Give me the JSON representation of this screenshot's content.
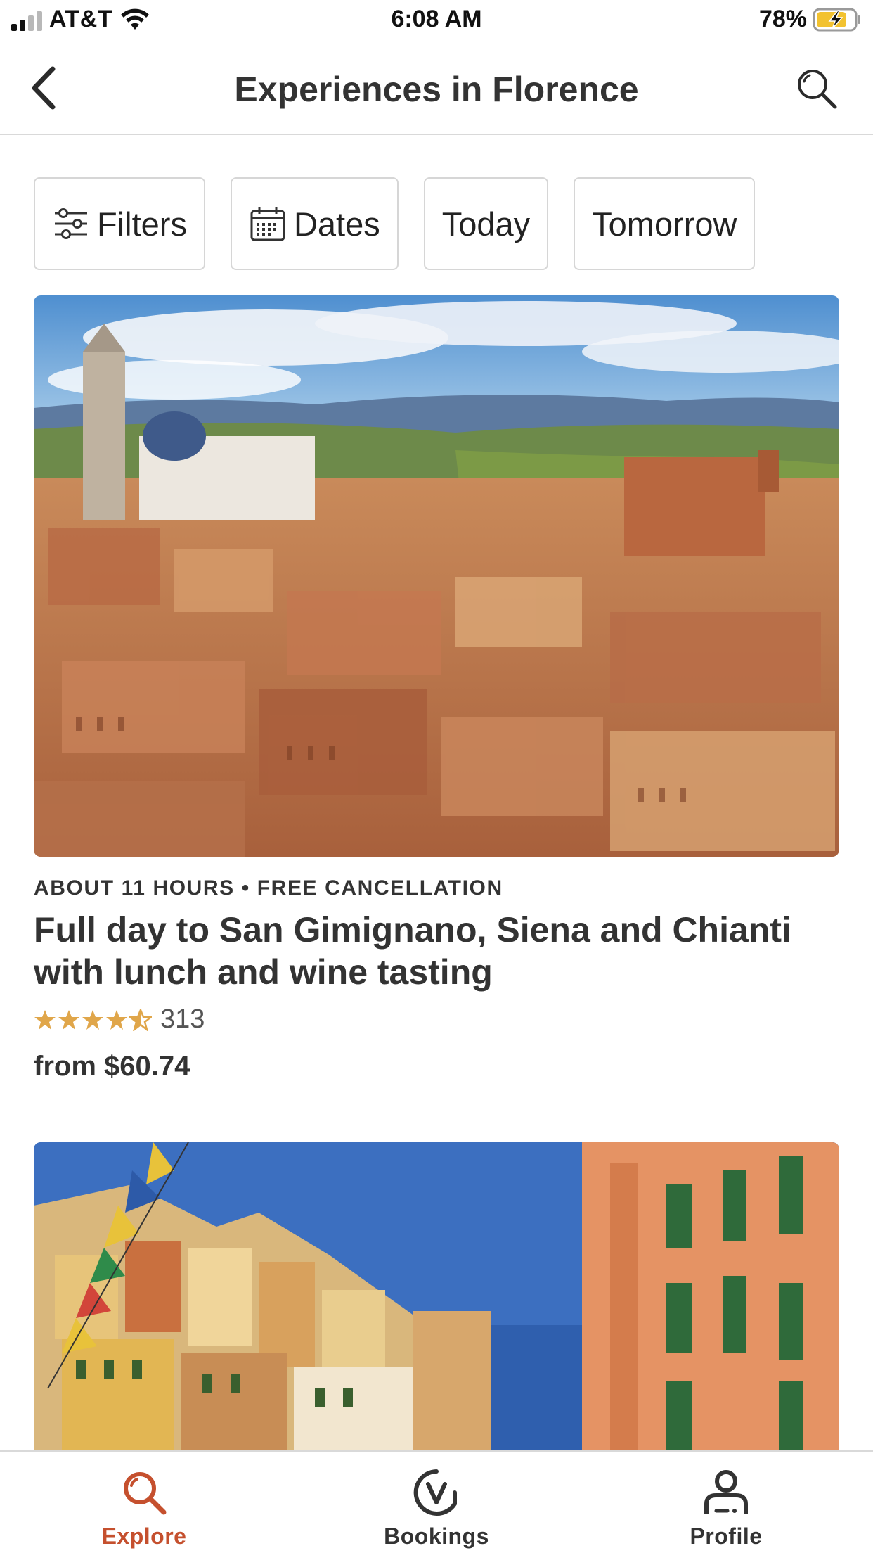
{
  "status_bar": {
    "carrier": "AT&T",
    "time": "6:08 AM",
    "battery_percent": "78%",
    "signal_bars_active": 2,
    "signal_bars_total": 4,
    "battery_level": 0.78,
    "battery_charging": true
  },
  "nav": {
    "title": "Experiences in Florence",
    "back_icon": "chevron-left-icon",
    "search_icon": "search-icon"
  },
  "filters": {
    "chips": [
      {
        "label": "Filters",
        "icon": "sliders-icon"
      },
      {
        "label": "Dates",
        "icon": "calendar-icon"
      },
      {
        "label": "Today"
      },
      {
        "label": "Tomorrow"
      }
    ]
  },
  "cards": [
    {
      "meta": "ABOUT 11 HOURS • FREE CANCELLATION",
      "title": "Full day to San Gimignano, Siena and Chianti with lunch and wine tasting",
      "rating": 4.5,
      "review_count": "313",
      "price": "from $60.74",
      "image": "siena-cityscape-photo"
    },
    {
      "image": "colorful-italian-village-photo"
    }
  ],
  "tab_bar": {
    "tabs": [
      {
        "label": "Explore",
        "icon": "search-icon",
        "active": true
      },
      {
        "label": "Bookings",
        "icon": "bookings-v-icon",
        "active": false
      },
      {
        "label": "Profile",
        "icon": "profile-icon",
        "active": false
      }
    ]
  },
  "colors": {
    "accent": "#c5502e",
    "star": "#e0a64a",
    "text": "#333333",
    "border": "#d6d6d6"
  }
}
